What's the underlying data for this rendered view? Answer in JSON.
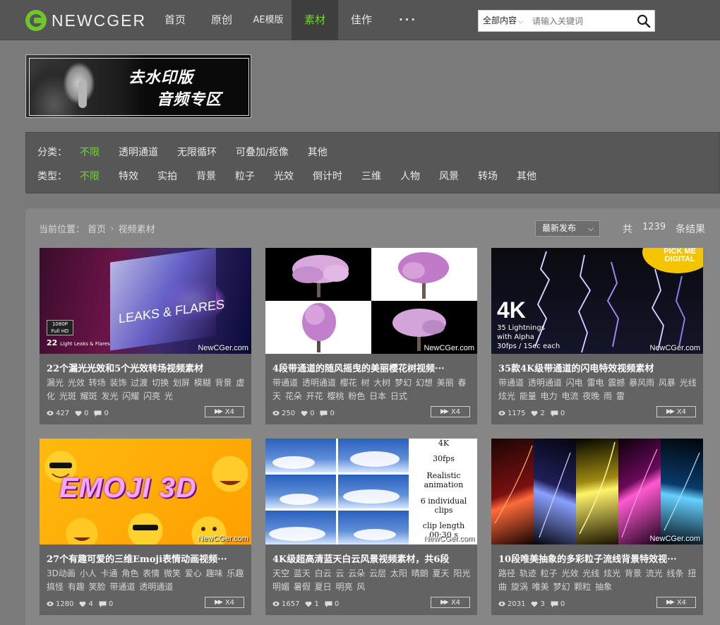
{
  "logo": {
    "text": "NEWCGER"
  },
  "nav": [
    {
      "label": "首页"
    },
    {
      "label": "原创"
    },
    {
      "label": "AE模版"
    },
    {
      "label": "素材"
    },
    {
      "label": "佳作"
    },
    {
      "label": "···"
    }
  ],
  "search": {
    "scope": "全部内容",
    "placeholder": "请输入关键词"
  },
  "banner": {
    "line1": "去水印版",
    "line2": "音频专区"
  },
  "filters": {
    "category": {
      "label": "分类：",
      "options": [
        "不限",
        "透明通道",
        "无限循环",
        "可叠加/抠像",
        "其他"
      ],
      "active": "不限"
    },
    "type": {
      "label": "类型：",
      "options": [
        "不限",
        "特效",
        "实拍",
        "背景",
        "粒子",
        "光效",
        "倒计时",
        "三维",
        "人物",
        "风景",
        "转场",
        "其他"
      ],
      "active": "不限"
    }
  },
  "breadcrumb": {
    "prefix": "当前位置：",
    "home": "首页",
    "current": "视频素材"
  },
  "sort": {
    "selected": "最新发布"
  },
  "results": {
    "prefix": "共",
    "count": "1239",
    "suffix": "条结果"
  },
  "watermark": "NewCGer.com",
  "cards": [
    {
      "title": "22个漏光光效和5个光效转场视频素材",
      "tags": "漏光 光效 转场 装饰 过渡 切换 划屏 模糊 背景 虚化 光斑 耀斑 发光 闪耀 闪亮 光",
      "views": "427",
      "likes": "0",
      "comments": "0",
      "speed": "X4",
      "thumb": {
        "line": "LEAKS & FLARES",
        "badge1": "1080P",
        "badge2": "Full HD",
        "count": "22",
        "sub": "Light Leaks & Flares"
      }
    },
    {
      "title": "4段带通道的随风摇曳的美丽樱花树视频···",
      "tags": "带通道 透明通道 樱花 树 大树 梦幻 幻想 美丽 春天 花朵 开花 樱桃 粉色 日本 日式",
      "views": "250",
      "likes": "0",
      "comments": "0",
      "speed": "X4"
    },
    {
      "title": "35款4K级带通道的闪电特效视频素材",
      "tags": "带通道 透明通道 闪电 雷电 震撼 暴风雨 风暴 光线 炫光 能量 电力 电流 夜晚 雨 雷",
      "views": "1175",
      "likes": "2",
      "comments": "0",
      "speed": "X4",
      "thumb": {
        "big": "4K",
        "line1": "35 Lightnings",
        "line2": "with Alpha",
        "line3": "30fps / 1Sec each",
        "pick1": "PICK ME",
        "pick2": "DIGITAL"
      }
    },
    {
      "title": "27个有趣可爱的三维Emoji表情动画视频···",
      "tags": "3D动画 小人 卡通 角色 表情 微笑 爱心 趣味 乐趣 搞怪 有趣 笑脸 带通道 透明通道",
      "views": "1280",
      "likes": "4",
      "comments": "0",
      "speed": "X4",
      "thumb": {
        "text": "EMOJI 3D"
      }
    },
    {
      "title": "4K级超高清蓝天白云风景视频素材，共6段",
      "tags": "天空 蓝天 白云 云 云朵 云层 太阳 晴朗 夏天 阳光 明媚 暑假 夏日 明亮 风",
      "views": "1657",
      "likes": "1",
      "comments": "0",
      "speed": "X4",
      "thumb": {
        "lines": [
          "4K",
          "30fps",
          "Realistic",
          "animation",
          "6 individual",
          "clips",
          "clip length",
          "00:30 s"
        ]
      }
    },
    {
      "title": "10段唯美抽象的多彩粒子流线背景特效视···",
      "tags": "路径 轨迹 粒子 光效 光线 炫光 背景 流光 线条 扭曲 旋涡 唯美 梦幻 颗粒 抽象",
      "views": "2031",
      "likes": "3",
      "comments": "0",
      "speed": "X4"
    }
  ],
  "colors": {
    "accent": "#6fd62b",
    "header": "#555555",
    "page": "#7a7a7a",
    "card": "#636363"
  }
}
